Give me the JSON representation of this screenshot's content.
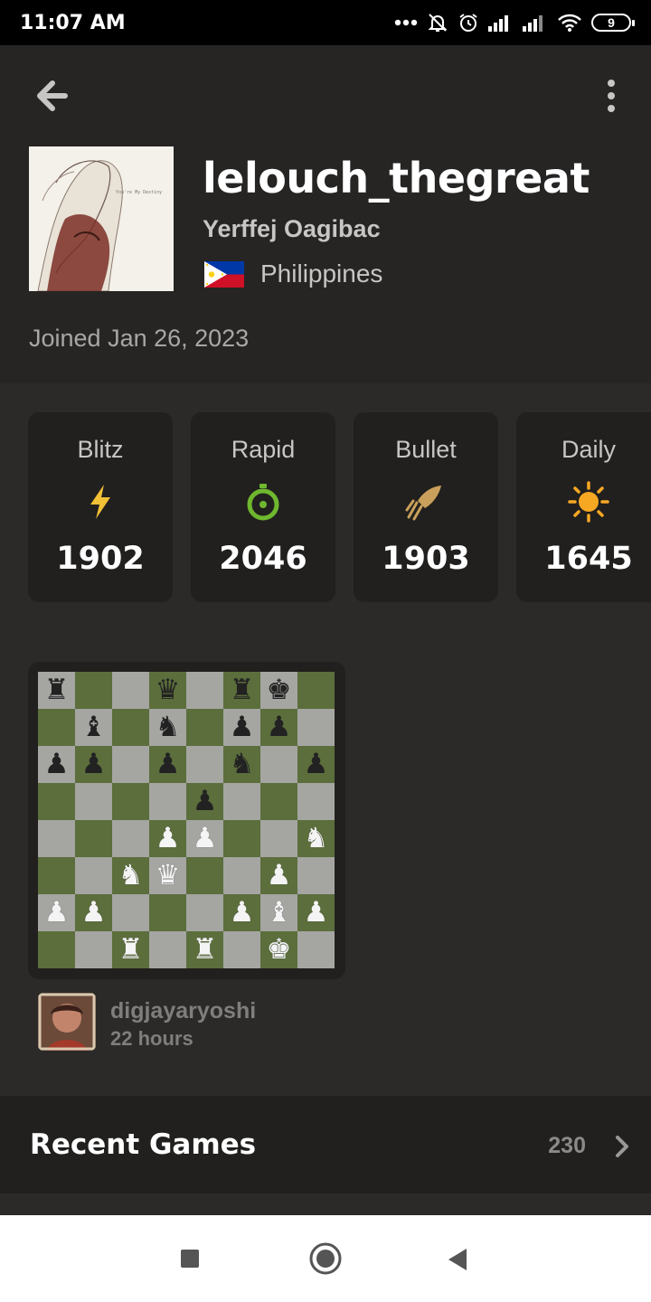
{
  "status_bar": {
    "time": "11:07 AM",
    "battery": "9"
  },
  "profile": {
    "username": "lelouch_thegreat",
    "real_name": "Yerffej Oagibac",
    "country": "Philippines",
    "joined": "Joined Jan 26, 2023"
  },
  "ratings": [
    {
      "label": "Blitz",
      "value": "1902",
      "icon": "lightning-icon",
      "color": "#f2c135"
    },
    {
      "label": "Rapid",
      "value": "2046",
      "icon": "stopwatch-icon",
      "color": "#6fb72f"
    },
    {
      "label": "Bullet",
      "value": "1903",
      "icon": "bullet-icon",
      "color": "#c9a05b"
    },
    {
      "label": "Daily",
      "value": "1645",
      "icon": "sun-icon",
      "color": "#f7a823"
    }
  ],
  "board": [
    [
      "bR",
      "",
      "",
      "bQ",
      "",
      "bR",
      "bK",
      ""
    ],
    [
      "",
      "bB",
      "",
      "bN",
      "",
      "bP",
      "bP",
      ""
    ],
    [
      "bP",
      "bP",
      "",
      "bP",
      "",
      "bN",
      "",
      "bP"
    ],
    [
      "",
      "",
      "",
      "",
      "bP",
      "",
      "",
      ""
    ],
    [
      "",
      "",
      "",
      "wP",
      "wP",
      "",
      "",
      "wN"
    ],
    [
      "",
      "",
      "wN",
      "wQ",
      "",
      "",
      "wP",
      ""
    ],
    [
      "wP",
      "wP",
      "",
      "",
      "",
      "wP",
      "wB",
      "wP"
    ],
    [
      "",
      "",
      "wR",
      "",
      "wR",
      "",
      "wK",
      ""
    ]
  ],
  "last_game": {
    "opponent": "digjayaryoshi",
    "time_ago": "22 hours"
  },
  "recent_games": {
    "title": "Recent Games",
    "count": "230"
  }
}
